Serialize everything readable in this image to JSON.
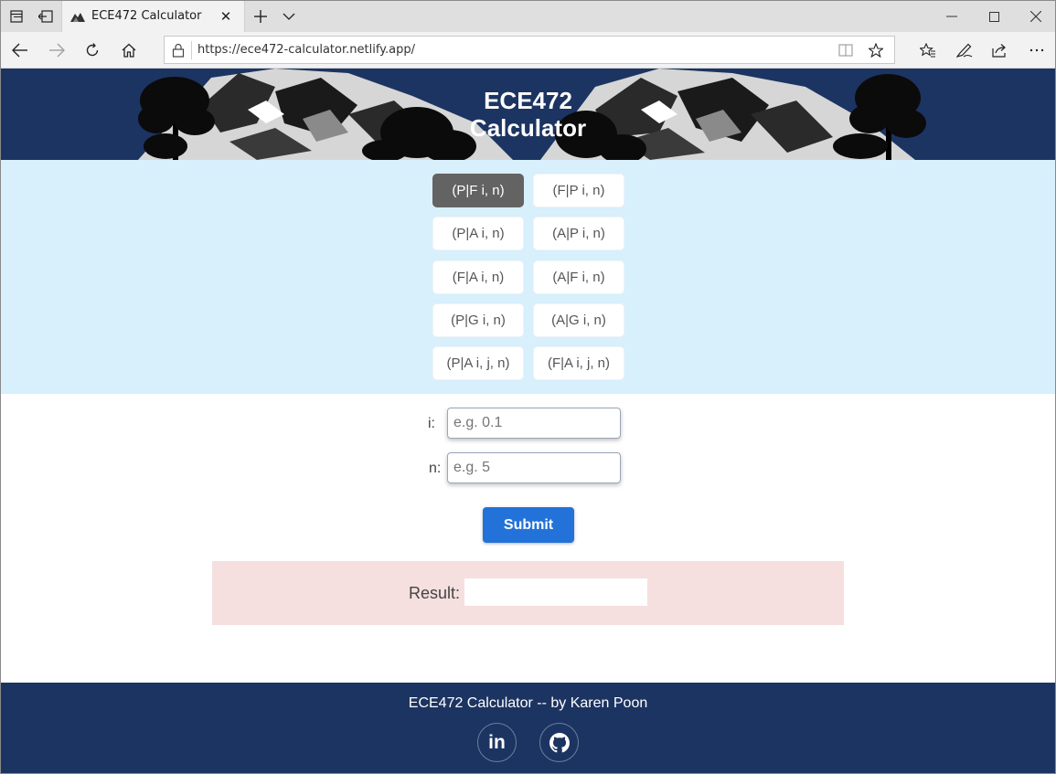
{
  "browser": {
    "tab_title": "ECE472 Calculator",
    "tab_close_glyph": "✕",
    "url": "https://ece472-calculator.netlify.app/",
    "icons": [
      "tab-list-icon",
      "set-aside-tabs-icon",
      "new-tab-icon",
      "tab-dropdown-icon",
      "minimize-icon",
      "maximize-icon",
      "close-icon",
      "back-icon",
      "forward-icon",
      "refresh-icon",
      "home-icon",
      "lock-icon",
      "reading-view-icon",
      "favorite-star-icon",
      "favorites-icon",
      "notes-icon",
      "share-icon",
      "more-icon"
    ]
  },
  "header": {
    "title_line1": "ECE472",
    "title_line2": "Calculator",
    "background_color": "#1c3461"
  },
  "formulas": {
    "items": [
      {
        "label": "(P|F i, n)",
        "active": true
      },
      {
        "label": "(F|P i, n)",
        "active": false
      },
      {
        "label": "(P|A i, n)",
        "active": false
      },
      {
        "label": "(A|P i, n)",
        "active": false
      },
      {
        "label": "(F|A i, n)",
        "active": false
      },
      {
        "label": "(A|F i, n)",
        "active": false
      },
      {
        "label": "(P|G i, n)",
        "active": false
      },
      {
        "label": "(A|G i, n)",
        "active": false
      },
      {
        "label": "(P|A i, j, n)",
        "active": false
      },
      {
        "label": "(F|A i, j, n)",
        "active": false
      }
    ],
    "background_color": "#d8effc",
    "active_color": "#636363"
  },
  "form": {
    "i_label": "i:",
    "i_placeholder": "e.g. 0.1",
    "i_value": "",
    "n_label": "n:",
    "n_placeholder": "e.g. 5",
    "n_value": "",
    "submit_label": "Submit",
    "submit_color": "#2372d9"
  },
  "result": {
    "label": "Result:",
    "value": "",
    "background_color": "#f5dfdf"
  },
  "footer": {
    "text": "ECE472 Calculator -- by Karen Poon",
    "links": [
      {
        "icon": "linkedin-icon",
        "glyph": "in"
      },
      {
        "icon": "github-icon"
      }
    ]
  }
}
